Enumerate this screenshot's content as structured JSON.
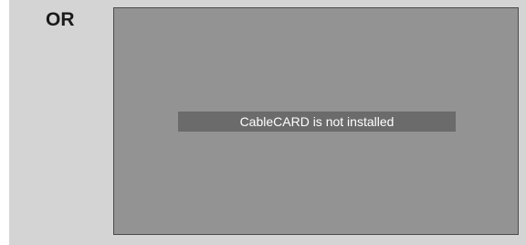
{
  "label": {
    "or_text": "OR"
  },
  "screen": {
    "message": "CableCARD is not installed"
  },
  "colors": {
    "panel_background": "#d4d4d4",
    "screen_background": "#939393",
    "message_bar_background": "#6b6b6b",
    "message_text": "#ffffff"
  }
}
